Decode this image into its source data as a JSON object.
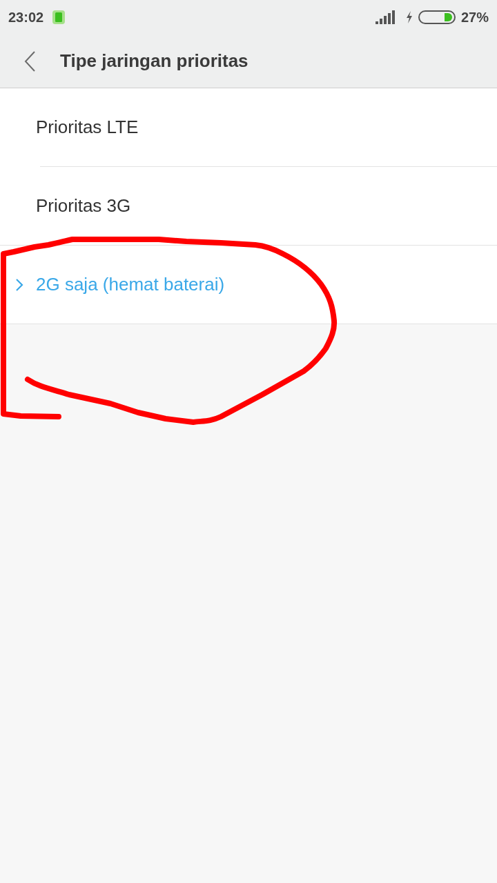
{
  "status_bar": {
    "time": "23:02",
    "battery_text": "27%"
  },
  "header": {
    "title": "Tipe jaringan prioritas"
  },
  "options": [
    {
      "label": "Prioritas LTE",
      "selected": false
    },
    {
      "label": "Prioritas 3G",
      "selected": false
    },
    {
      "label": "2G saja (hemat baterai)",
      "selected": true
    }
  ],
  "annotations": [
    {
      "kind": "freehand-loop"
    }
  ]
}
